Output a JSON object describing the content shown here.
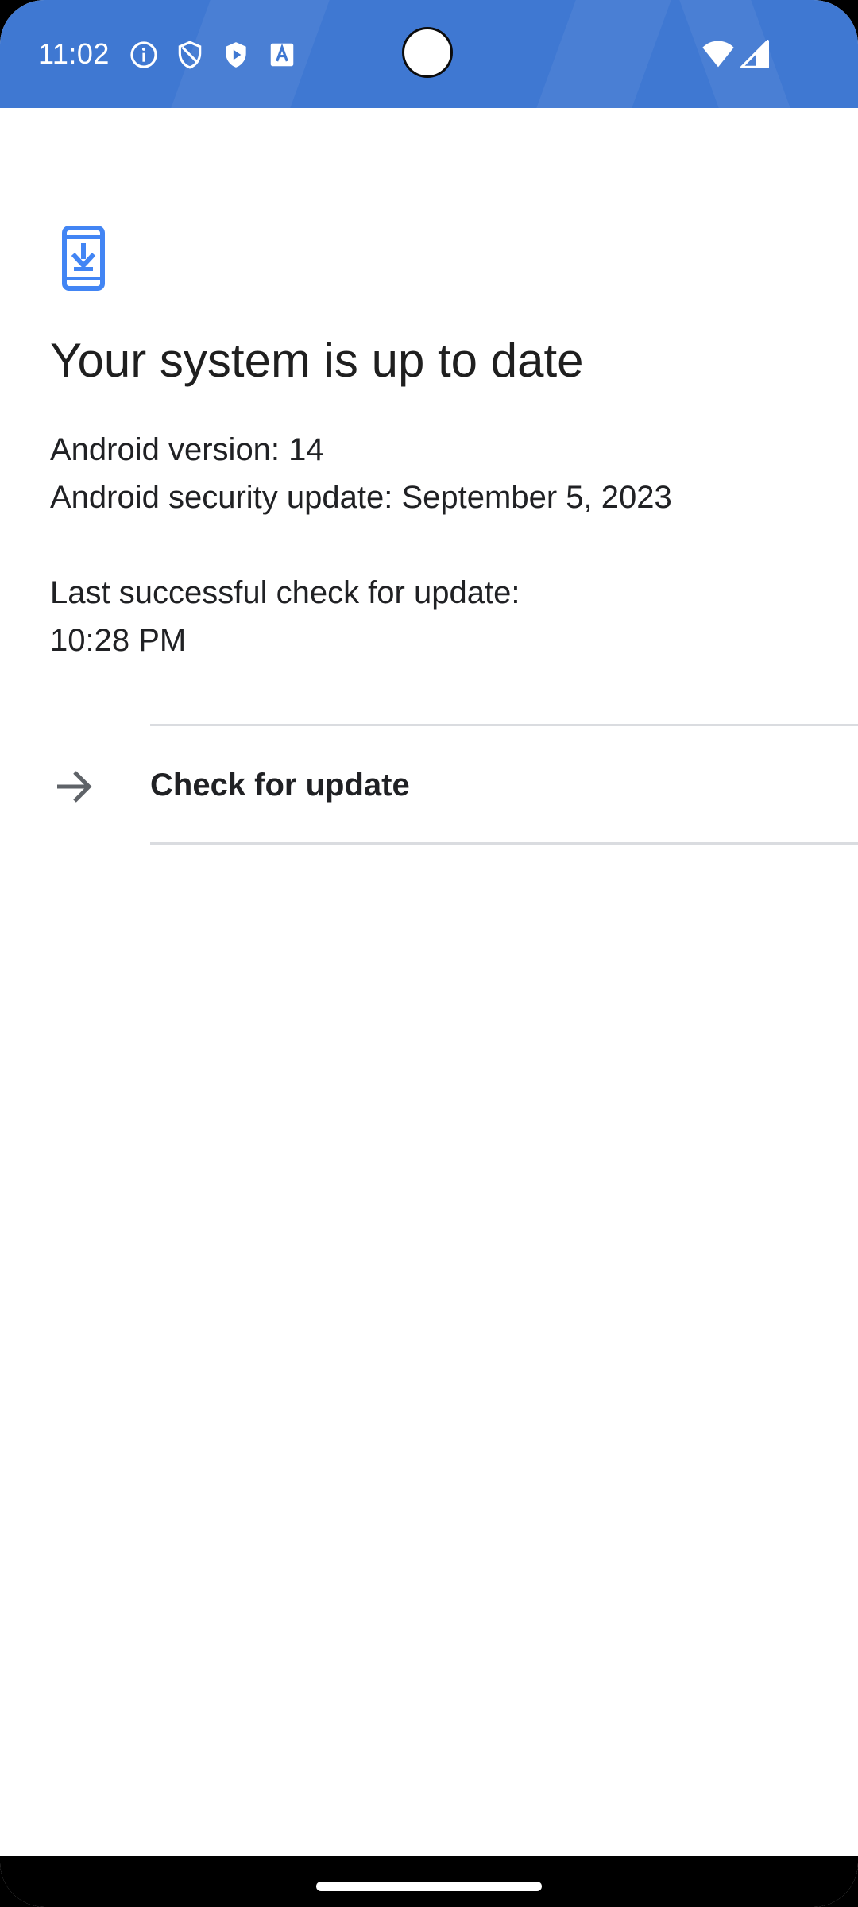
{
  "status_bar": {
    "time": "11:02",
    "left_icons": [
      "info-icon",
      "shield-icon",
      "play-shield-icon",
      "font-a-icon"
    ],
    "right_icons": [
      "wifi-icon",
      "signal-icon"
    ],
    "background_color": "#3f78d2"
  },
  "main": {
    "status_icon": "phone-download-icon",
    "title": "Your system is up to date",
    "android_version": "Android version: 14",
    "security_update": "Android security update: September 5, 2023",
    "last_check_label": "Last successful check for update:",
    "last_check_time": "10:28 PM",
    "check_button_label": "Check for update",
    "accent_color": "#4285f4"
  },
  "nav_bar": {
    "gesture": "home-handle"
  }
}
